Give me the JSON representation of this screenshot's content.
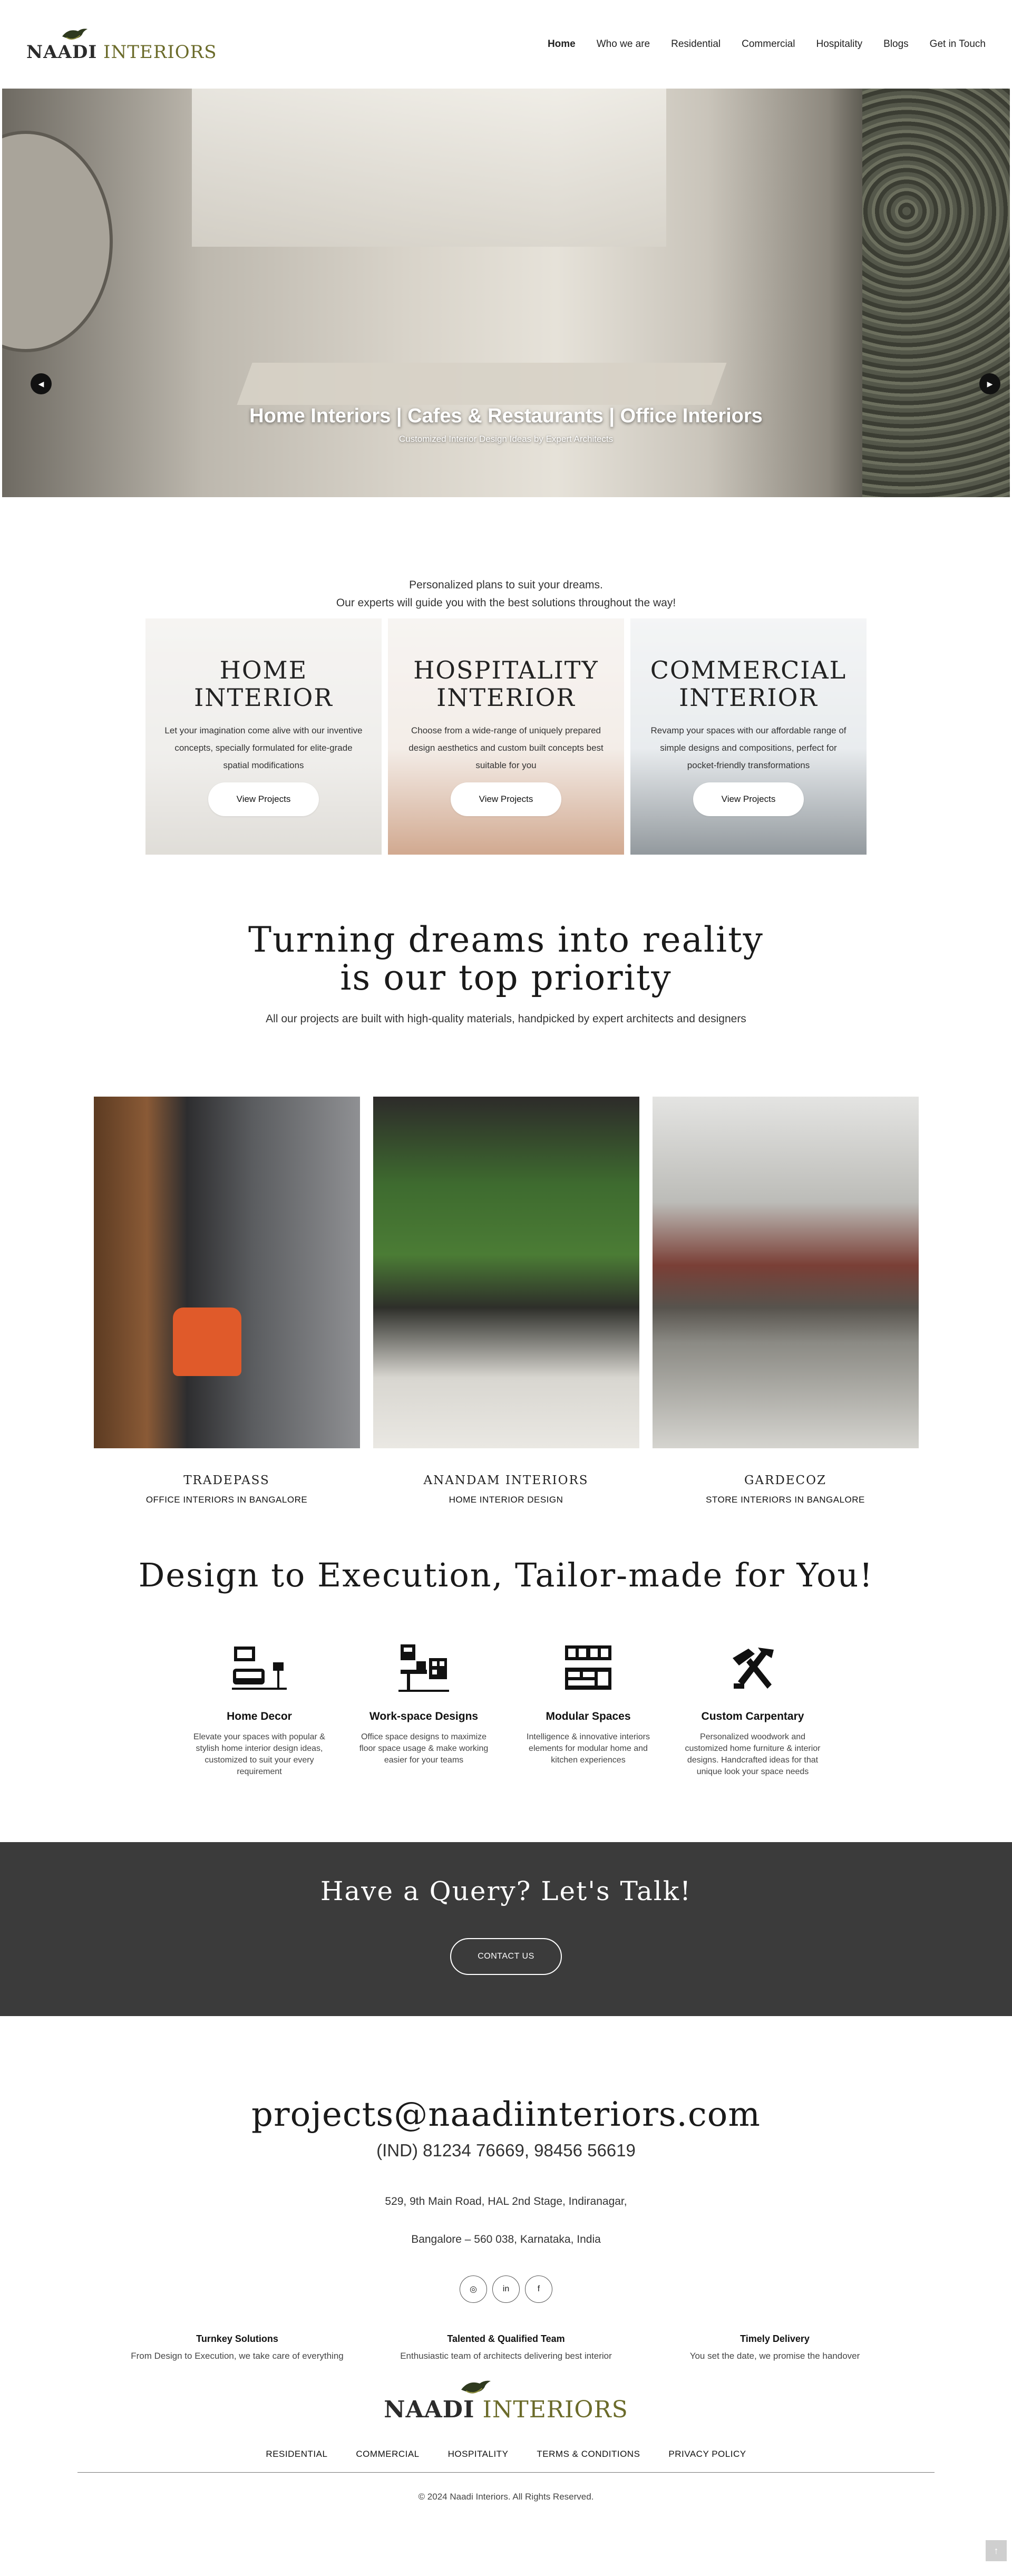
{
  "header": {
    "logo_main": "NAADI",
    "logo_sub": "INTERIORS",
    "nav": [
      "Home",
      "Who we are",
      "Residential",
      "Commercial",
      "Hospitality",
      "Blogs",
      "Get in Touch"
    ]
  },
  "hero": {
    "title": "Home Interiors | Cafes & Restaurants | Office Interiors",
    "subtitle": "Customized Interior Design Ideas by Expert Architects",
    "prev_icon": "chevron-left-icon",
    "next_icon": "chevron-right-icon"
  },
  "intro": {
    "line1": "Personalized plans to suit your dreams.",
    "line2": "Our experts will guide you with the best solutions throughout the way!"
  },
  "cards": [
    {
      "title1": "HOME",
      "title2": "INTERIOR",
      "desc": "Let your imagination come alive with our inventive concepts, specially formulated for elite-grade spatial modifications",
      "button": "View Projects"
    },
    {
      "title1": "HOSPITALITY",
      "title2": "INTERIOR",
      "desc": "Choose from a wide-range of uniquely prepared design aesthetics and custom built concepts best suitable for you",
      "button": "View Projects"
    },
    {
      "title1": "COMMERCIAL",
      "title2": "INTERIOR",
      "desc": "Revamp your spaces with our affordable range of simple designs and compositions, perfect for pocket-friendly transformations",
      "button": "View Projects"
    }
  ],
  "dreams": {
    "line1": "Turning dreams into reality",
    "line2": "is our top priority",
    "subtitle": "All our projects are built with high-quality materials, handpicked by expert architects and designers"
  },
  "projects": [
    {
      "name": "TRADEPASS",
      "category": "OFFICE INTERIORS IN BANGALORE"
    },
    {
      "name": "ANANDAM INTERIORS",
      "category": "HOME INTERIOR DESIGN"
    },
    {
      "name": "GARDECOZ",
      "category": "STORE INTERIORS IN BANGALORE"
    }
  ],
  "d2e": {
    "title": "Design to Execution, Tailor-made for You!",
    "features": [
      {
        "icon": "home-decor-icon",
        "title": "Home Decor",
        "desc": "Elevate your spaces with popular & stylish home interior design ideas, customized to suit your every requirement"
      },
      {
        "icon": "workspace-icon",
        "title": "Work-space Designs",
        "desc": "Office space designs to maximize floor space usage & make working easier for your teams"
      },
      {
        "icon": "modular-kitchen-icon",
        "title": "Modular Spaces",
        "desc": "Intelligence & innovative interiors elements for modular home and kitchen experiences"
      },
      {
        "icon": "carpentry-tools-icon",
        "title": "Custom Carpentary",
        "desc": "Personalized woodwork and customized home furniture & interior designs. Handcrafted ideas for that unique look your space needs"
      }
    ]
  },
  "query": {
    "title": "Have a Query? Let's Talk!",
    "button": "CONTACT US"
  },
  "contact": {
    "email": "projects@naadiinteriors.com",
    "phone": "(IND) 81234 76669,  98456 56619",
    "address1": "529, 9th Main Road, HAL 2nd Stage, Indiranagar,",
    "address2": "Bangalore – 560 038, Karnataka, India",
    "socials": [
      {
        "icon": "instagram-icon",
        "glyph": "◎"
      },
      {
        "icon": "linkedin-icon",
        "glyph": "in"
      },
      {
        "icon": "facebook-icon",
        "glyph": "f"
      }
    ]
  },
  "highlights": [
    {
      "title": "Turnkey Solutions",
      "desc": "From Design to Execution, we take care of everything"
    },
    {
      "title": "Talented & Qualified Team",
      "desc": "Enthusiastic team of architects delivering best interior"
    },
    {
      "title": "Timely Delivery",
      "desc": "You set the date, we promise the handover"
    }
  ],
  "footer": {
    "logo_main": "NAADI",
    "logo_sub": "INTERIORS",
    "links": [
      "RESIDENTIAL",
      "COMMERCIAL",
      "HOSPITALITY",
      "TERMS & CONDITIONS",
      "PRIVACY POLICY"
    ],
    "copyright": "© 2024 Naadi Interiors. All Rights Reserved.",
    "to_top_icon": "arrow-up-icon"
  },
  "colors": {
    "accent": "#6b6b2a",
    "band": "#3b3b3b",
    "text": "#222222"
  }
}
